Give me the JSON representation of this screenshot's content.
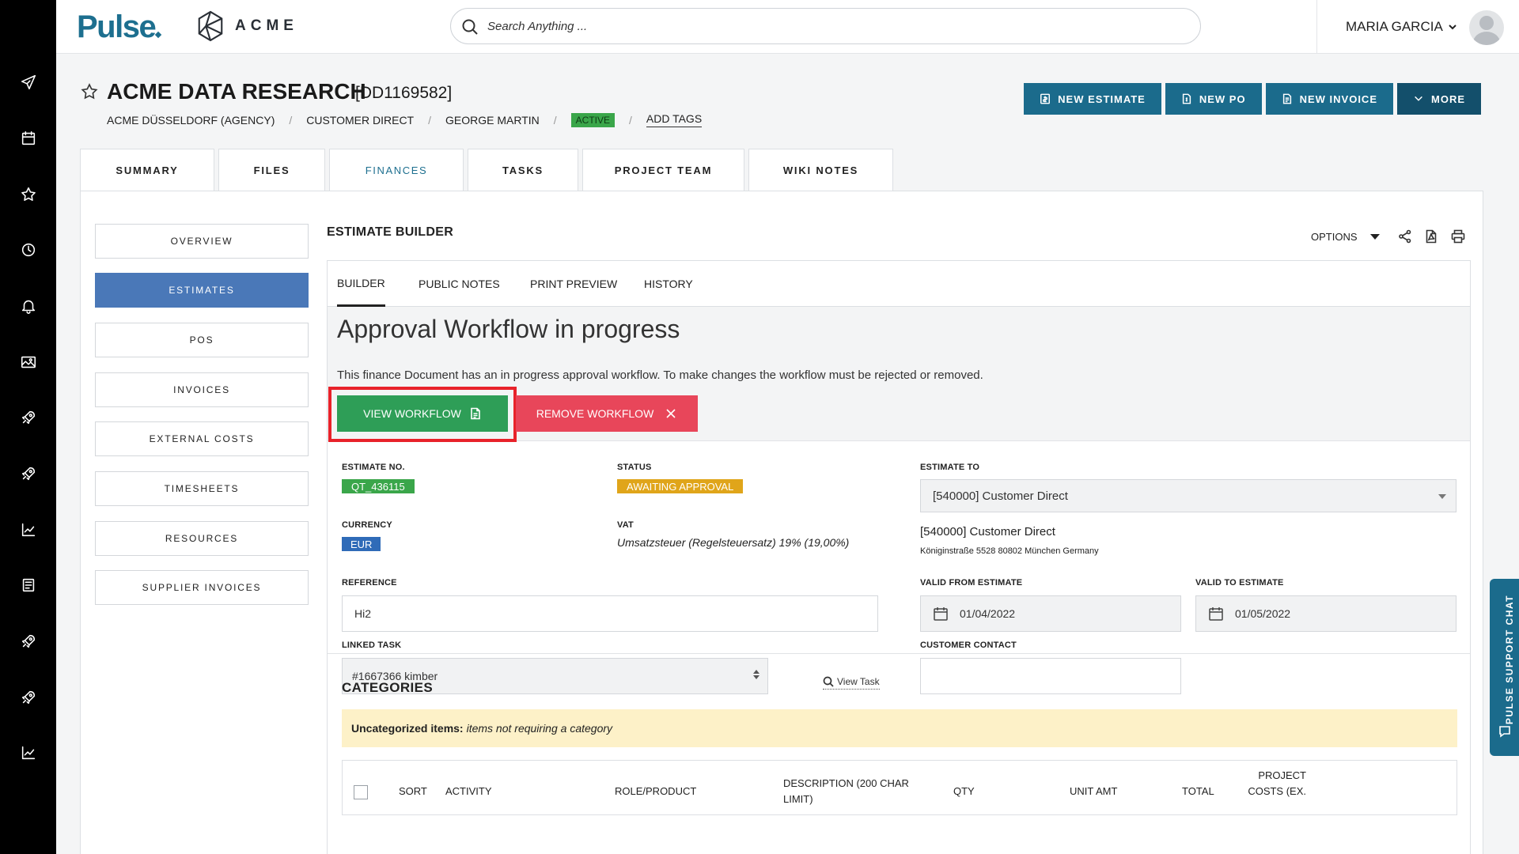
{
  "header": {
    "logo_text": "Pulse",
    "company_text": "ACME",
    "search_placeholder": "Search Anything ...",
    "user_name": "MARIA GARCIA"
  },
  "rail": {
    "icons": [
      "send-icon",
      "calendar-icon",
      "star-icon",
      "clock-icon",
      "bell-icon",
      "image-icon",
      "rocket-icon",
      "rocket-icon",
      "chart-icon",
      "book-icon",
      "rocket-icon",
      "rocket-icon",
      "chart-icon"
    ]
  },
  "project": {
    "title": "ACME DATA RESEARCH",
    "code": "[DD1169582]",
    "breadcrumb": {
      "agency": "ACME DÜSSELDORF (AGENCY)",
      "client": "CUSTOMER DIRECT",
      "manager": "GEORGE MARTIN",
      "status": "ACTIVE",
      "add_tags": "ADD TAGS"
    }
  },
  "actions": {
    "new_estimate": "NEW ESTIMATE",
    "new_po": "NEW PO",
    "new_invoice": "NEW INVOICE",
    "more": "MORE"
  },
  "main_tabs": [
    "SUMMARY",
    "FILES",
    "FINANCES",
    "TASKS",
    "PROJECT TEAM",
    "WIKI NOTES"
  ],
  "active_main_tab": "FINANCES",
  "side_nav": [
    "OVERVIEW",
    "ESTIMATES",
    "POS",
    "INVOICES",
    "EXTERNAL COSTS",
    "TIMESHEETS",
    "RESOURCES",
    "SUPPLIER INVOICES"
  ],
  "active_side_nav": "ESTIMATES",
  "builder": {
    "title": "ESTIMATE BUILDER",
    "options_label": "OPTIONS",
    "sub_tabs": [
      "BUILDER",
      "PUBLIC NOTES",
      "PRINT PREVIEW",
      "HISTORY"
    ],
    "active_sub_tab": "BUILDER"
  },
  "workflow": {
    "heading": "Approval Workflow in progress",
    "message": "This finance Document has an in progress approval workflow. To make changes the workflow must be rejected or removed.",
    "view_label": "VIEW WORKFLOW",
    "remove_label": "REMOVE WORKFLOW"
  },
  "estimate": {
    "no_label": "ESTIMATE NO.",
    "no_value": "QT_436115",
    "status_label": "STATUS",
    "status_value": "AWAITING APPROVAL",
    "estimate_to_label": "ESTIMATE TO",
    "estimate_to_value": "[540000] Customer Direct",
    "estimate_to_name": "[540000] Customer Direct",
    "estimate_to_address": "Königinstraße 5528 80802 München Germany",
    "currency_label": "CURRENCY",
    "currency_value": "EUR",
    "vat_label": "VAT",
    "vat_value": "Umsatzsteuer (Regelsteuersatz) 19% (19,00%)",
    "reference_label": "REFERENCE",
    "reference_value": "Hi2",
    "valid_from_label": "VALID FROM ESTIMATE",
    "valid_from_value": "01/04/2022",
    "valid_to_label": "VALID TO ESTIMATE",
    "valid_to_value": "01/05/2022",
    "linked_task_label": "LINKED TASK",
    "linked_task_value": "#1667366 kimber",
    "view_task": "View Task",
    "customer_contact_label": "CUSTOMER CONTACT",
    "customer_contact_value": ""
  },
  "categories": {
    "heading": "CATEGORIES",
    "uncat_bold": "Uncategorized items:",
    "uncat_text": "items not requiring a category",
    "columns": [
      "SORT",
      "ACTIVITY",
      "ROLE/PRODUCT",
      "DESCRIPTION (200 CHAR LIMIT)",
      "QTY",
      "UNIT AMT",
      "TOTAL",
      "PROJECT COSTS (EX."
    ]
  },
  "support": {
    "label": "PULSE SUPPORT CHAT"
  },
  "colors": {
    "brand": "#1b6b8c",
    "active_nav": "#4a78b8",
    "view_button": "#2e9e57",
    "remove_button": "#e8465a",
    "highlight": "#e8222a",
    "status_yellow": "#e0a51a",
    "estimate_green": "#3aa64a",
    "currency_blue": "#2f6bb8"
  }
}
